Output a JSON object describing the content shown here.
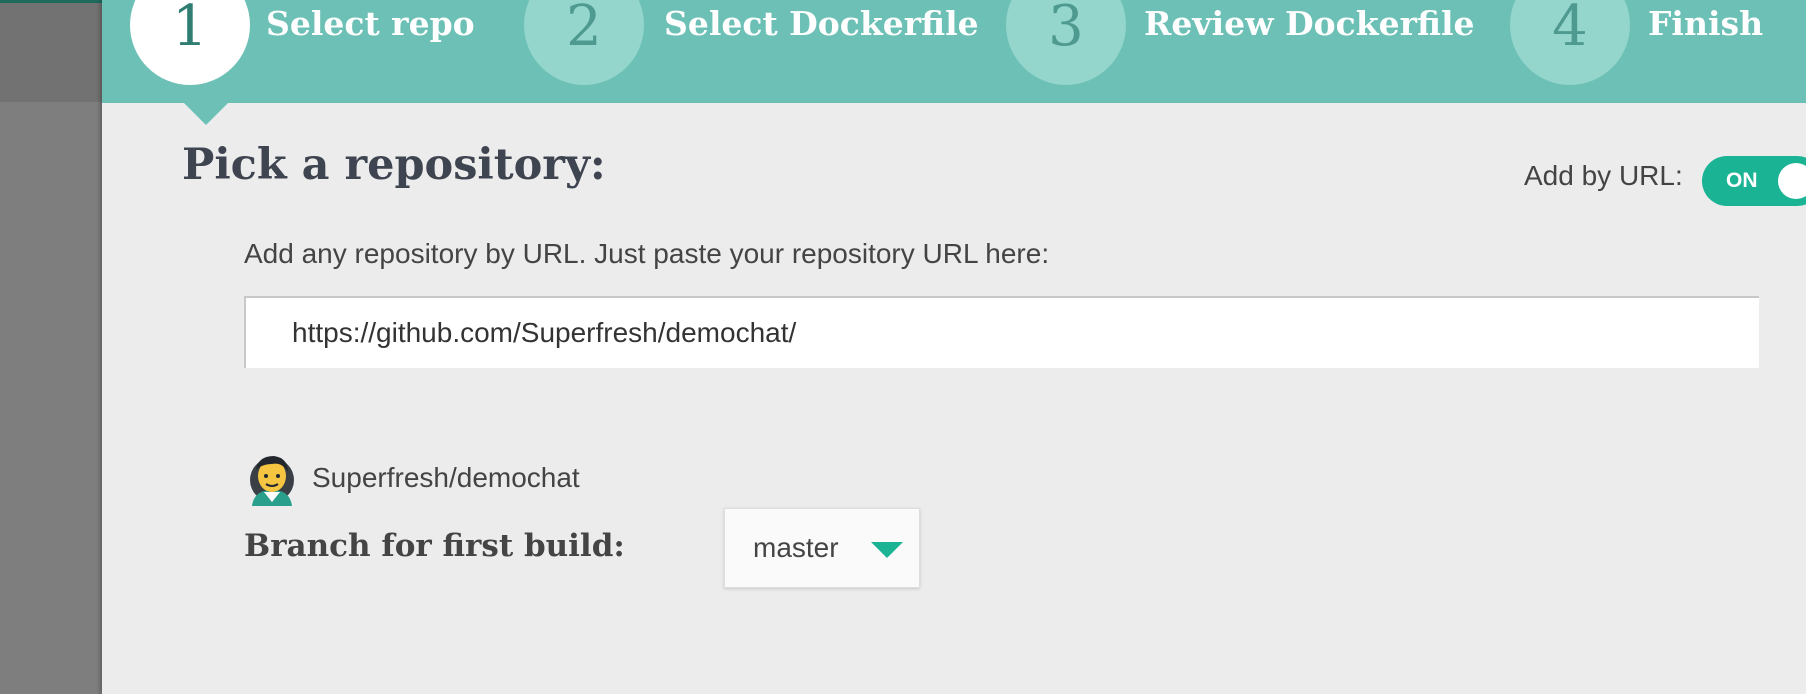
{
  "wizard": {
    "steps": [
      {
        "number": "1",
        "label": "Select repo",
        "active": true
      },
      {
        "number": "2",
        "label": "Select Dockerfile",
        "active": false
      },
      {
        "number": "3",
        "label": "Review Dockerfile",
        "active": false
      },
      {
        "number": "4",
        "label": "Finish",
        "active": false
      }
    ]
  },
  "main": {
    "heading": "Pick a repository:",
    "add_by_url": {
      "label": "Add by URL:",
      "state": "ON"
    },
    "instructions": "Add any repository by URL. Just paste your repository URL here:",
    "url_input": {
      "value": "https://github.com/Superfresh/demochat/"
    },
    "repo": {
      "name": "Superfresh/demochat",
      "avatar_icon": "avatar-icon"
    },
    "branch": {
      "label": "Branch for first build:",
      "selected": "master"
    }
  },
  "colors": {
    "accent": "#1ab394",
    "stepper_bg": "#6cc0b5",
    "panel_bg": "#ececec"
  }
}
